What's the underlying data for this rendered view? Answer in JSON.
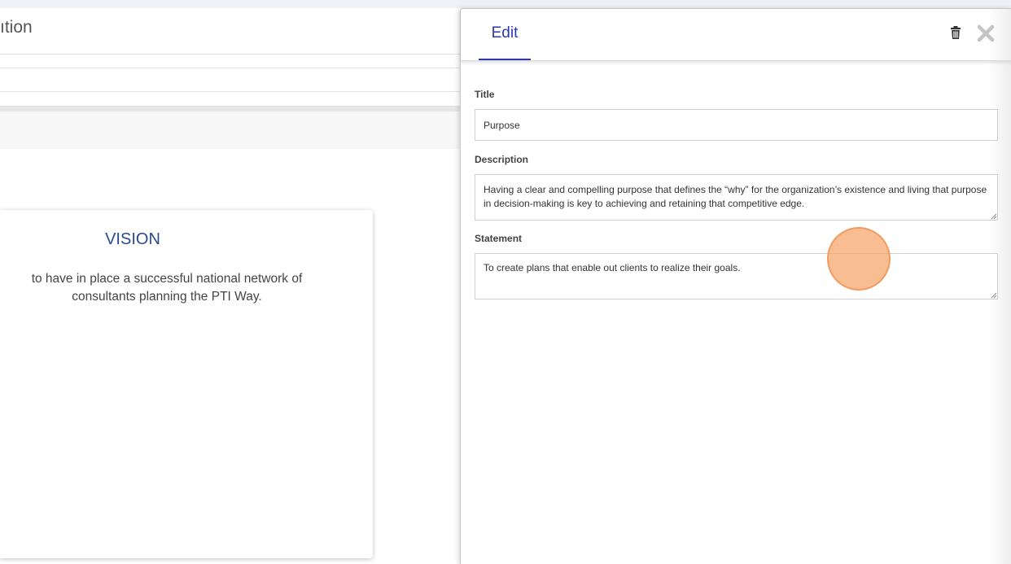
{
  "background": {
    "header_title": "ıtion",
    "vision_card": {
      "title": "VISION",
      "text": "to have in place a successful national network of consultants planning the PTI Way."
    }
  },
  "edit_panel": {
    "tab_label": "Edit",
    "icons": {
      "delete": "trash-icon",
      "close": "close-icon"
    },
    "fields": {
      "title": {
        "label": "Title",
        "value": "Purpose"
      },
      "description": {
        "label": "Description",
        "value": "Having a clear and compelling purpose that defines the “why” for the organization’s existence and living that purpose in decision-making is key to achieving and retaining that competitive edge."
      },
      "statement": {
        "label": "Statement",
        "value": "To create plans that enable out clients to realize their goals."
      }
    }
  },
  "colors": {
    "accent": "#2b3aa8",
    "vision_title": "#2a4a8c",
    "cursor_highlight": "#f7a468"
  }
}
